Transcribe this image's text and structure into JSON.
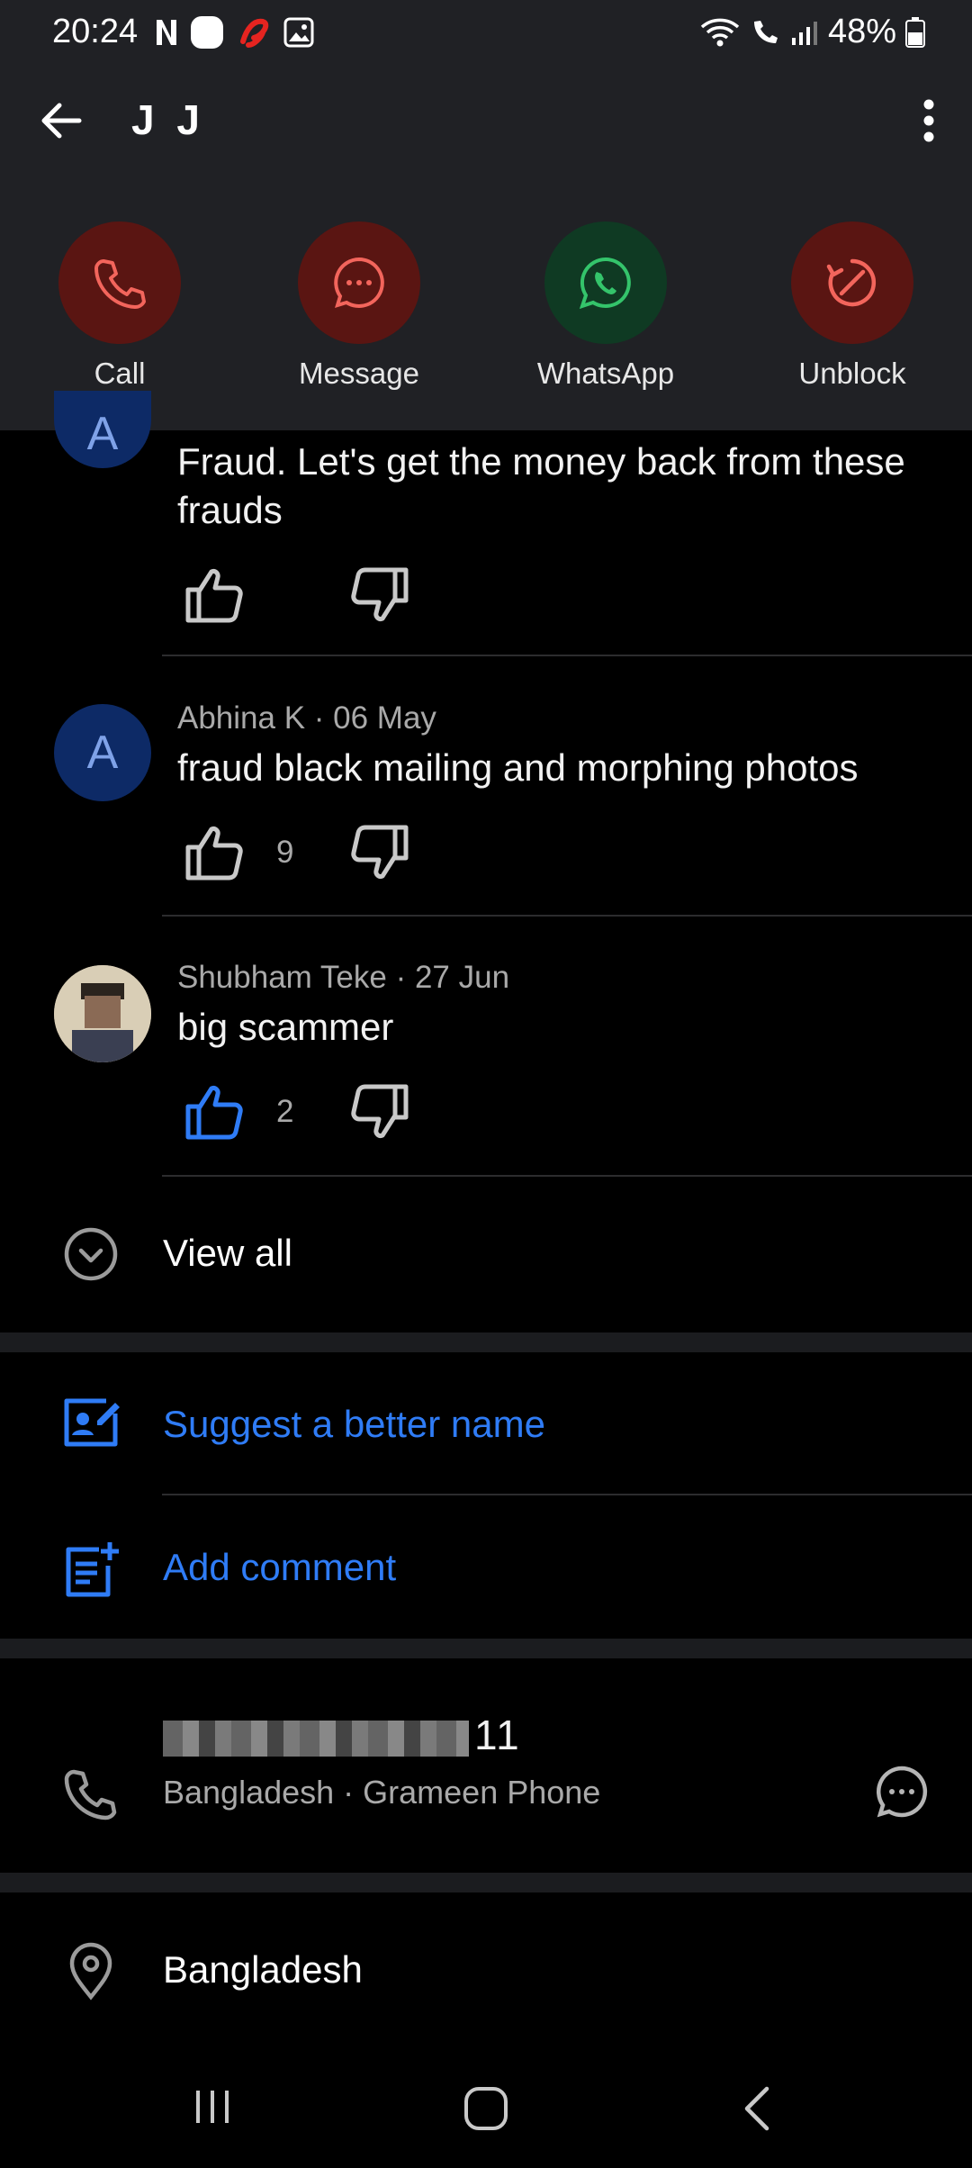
{
  "status_bar": {
    "time": "20:24",
    "battery": "48%"
  },
  "header": {
    "title": "J J"
  },
  "actions": [
    {
      "label": "Call"
    },
    {
      "label": "Message"
    },
    {
      "label": "WhatsApp"
    },
    {
      "label": "Unblock"
    }
  ],
  "comments": [
    {
      "initial": "A",
      "meta": "",
      "text": "Fraud. Let's get the money back from these frauds",
      "likes": ""
    },
    {
      "initial": "A",
      "meta": "Abhina K · 06 May",
      "text": "fraud black mailing and morphing photos",
      "likes": "9"
    },
    {
      "initial": "",
      "meta": "Shubham Teke · 27 Jun",
      "text": "big scammer",
      "likes": "2"
    }
  ],
  "view_all_label": "View all",
  "suggest_label": "Suggest a better name",
  "add_comment_label": "Add comment",
  "phone": {
    "number_suffix": "11",
    "carrier": "Bangladesh · Grameen Phone"
  },
  "location": {
    "country": "Bangladesh"
  },
  "colors": {
    "accent": "#2f7cf6",
    "bar": "#202125",
    "red_circle": "#5a1512",
    "green_circle": "#0f3a23"
  }
}
